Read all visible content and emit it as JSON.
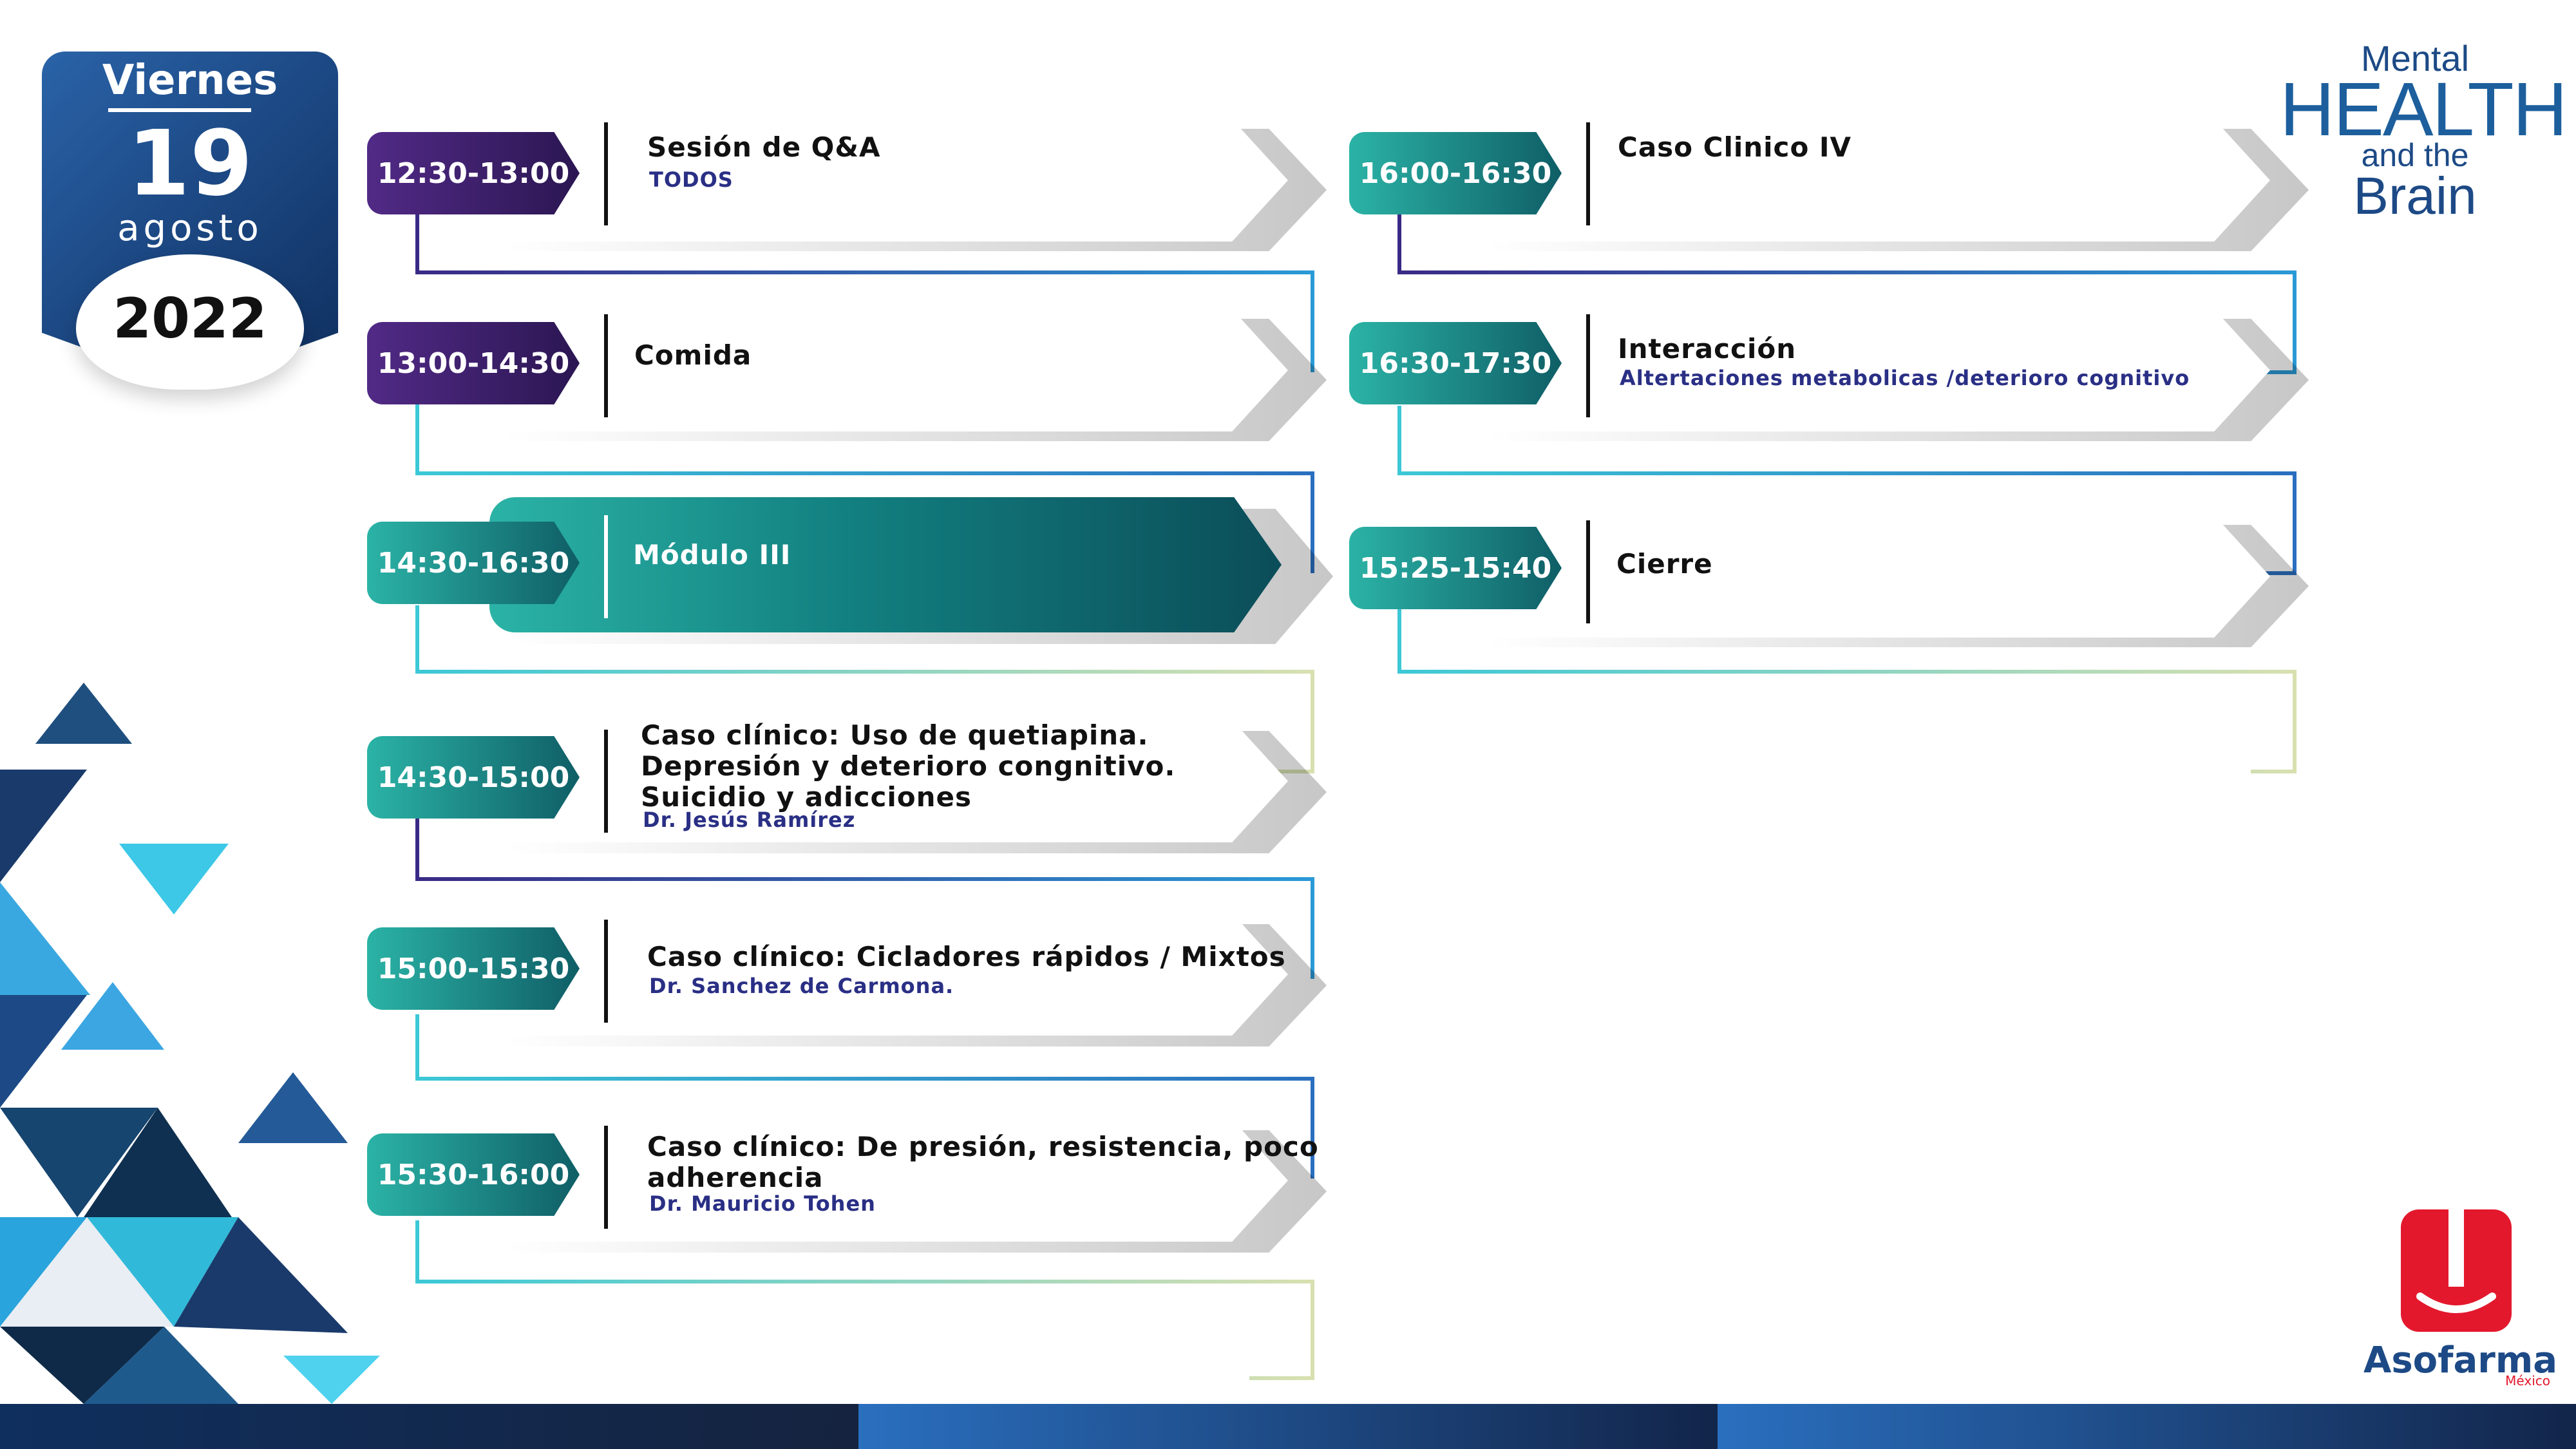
{
  "date": {
    "weekday": "Viernes",
    "day": "19",
    "month": "agosto",
    "year": "2022"
  },
  "brand": {
    "line1": "Mental",
    "line2": "HEALTH",
    "line3": "and the",
    "line4": "Brain"
  },
  "sponsor": {
    "name": "Asofarma",
    "country": "México"
  },
  "schedule_left": [
    {
      "time": "12:30-13:00",
      "title": "Sesión de Q&A",
      "speaker": "TODOS"
    },
    {
      "time": "13:00-14:30",
      "title": "Comida",
      "speaker": ""
    },
    {
      "time": "14:30-16:30",
      "title": "Módulo III",
      "speaker": ""
    },
    {
      "time": "14:30-15:00",
      "title_lines": [
        "Caso clínico: Uso de quetiapina.",
        "Depresión y deterioro congnitivo.",
        "Suicidio y adicciones"
      ],
      "speaker": "Dr. Jesús Ramírez"
    },
    {
      "time": "15:00-15:30",
      "title": "Caso clínico: Cicladores rápidos / Mixtos",
      "speaker": "Dr. Sanchez de Carmona."
    },
    {
      "time": "15:30-16:00",
      "title_lines": [
        "Caso clínico: De presión, resistencia, poco",
        "adherencia"
      ],
      "speaker": "Dr. Mauricio Tohen"
    }
  ],
  "schedule_right": [
    {
      "time": "16:00-16:30",
      "title": "Caso Clinico IV",
      "speaker": ""
    },
    {
      "time": "16:30-17:30",
      "title": "Interacción",
      "speaker": "Altertaciones metabolicas /deterioro cognitivo"
    },
    {
      "time": "15:25-15:40",
      "title": "Cierre",
      "speaker": ""
    }
  ],
  "colors": {
    "navy": "#1d4a86",
    "purple": "#3a1f6b",
    "teal": "#1a9a95",
    "speaker": "#2a2f85",
    "sponsor_red": "#e3182d"
  }
}
